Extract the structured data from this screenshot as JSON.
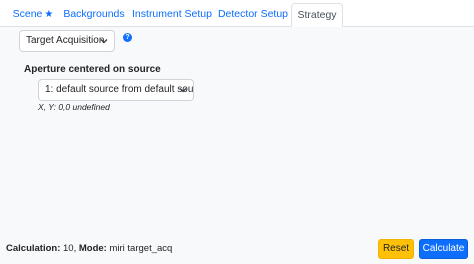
{
  "tabs": [
    {
      "label": "Scene",
      "active": false
    },
    {
      "label": "Backgrounds",
      "active": false
    },
    {
      "label": "Instrument Setup",
      "active": false
    },
    {
      "label": "Detector Setup",
      "active": false
    },
    {
      "label": "Strategy",
      "active": true
    }
  ],
  "strategy": {
    "mode_select": "Target Acquisition",
    "aperture_label": "Aperture centered on source",
    "source_select": "1: default source from default sou",
    "coordinates": "X, Y: 0,0 undefined"
  },
  "footer": {
    "calc_label": "Calculation:",
    "calc_value": "10",
    "mode_label": "Mode:",
    "mode_value": "miri target_acq",
    "reset_label": "Reset",
    "calculate_label": "Calculate"
  },
  "colors": {
    "link": "#0d6efd",
    "reset_button": "#ffc107",
    "calculate_button": "#0d6efd"
  },
  "icons": {
    "scene_tab": "star-icon",
    "help": "question-icon",
    "select": "chevron-down-icon"
  }
}
